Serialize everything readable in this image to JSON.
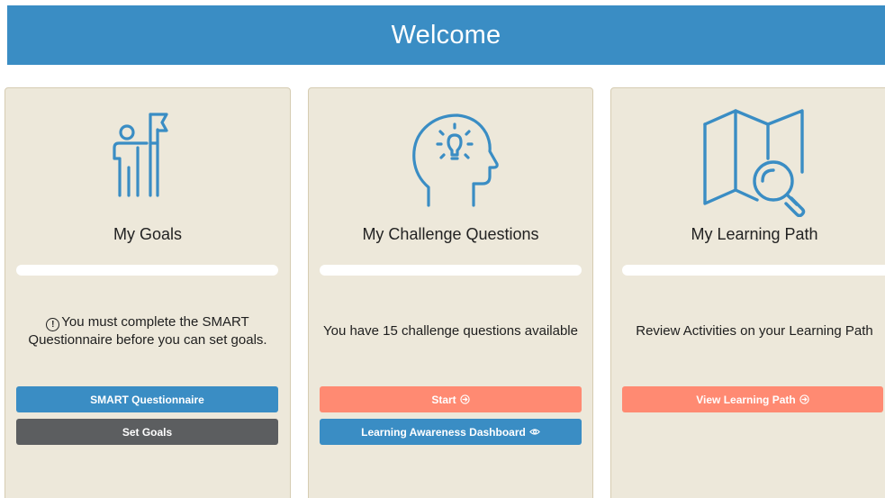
{
  "header": {
    "title": "Welcome"
  },
  "cards": {
    "goals": {
      "title": "My Goals",
      "icon": "person-with-flag-icon",
      "progress": 0,
      "message": "You must complete the SMART Questionnaire before you can set goals.",
      "buttons": {
        "primary": "SMART Questionnaire",
        "secondary": "Set Goals"
      }
    },
    "challenge": {
      "title": "My Challenge Questions",
      "icon": "head-lightbulb-icon",
      "progress": 0,
      "message": "You have 15 challenge questions available",
      "buttons": {
        "primary": "Start",
        "secondary": "Learning Awareness Dashboard"
      }
    },
    "learning": {
      "title": "My Learning Path",
      "icon": "map-magnifier-icon",
      "progress": 0,
      "message": "Review Activities on your Learning Path",
      "buttons": {
        "primary": "View Learning Path"
      }
    }
  },
  "colors": {
    "header_bg": "#3a8dc4",
    "card_bg": "#ede8da",
    "icon_stroke": "#3a8dc4",
    "button_blue": "#3a8dc4",
    "button_gray": "#5c5e60",
    "button_salmon": "#ff8a72"
  }
}
